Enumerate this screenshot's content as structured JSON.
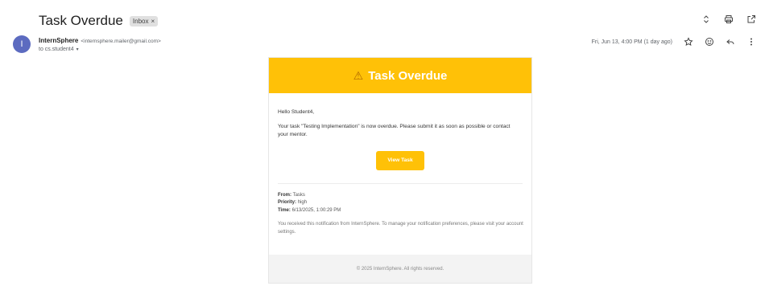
{
  "subject": "Task Overdue",
  "inbox_label": "Inbox",
  "inbox_remove": "×",
  "avatar_initial": "I",
  "sender": {
    "name": "InternSphere",
    "email": "<internsphere.mailer@gmail.com>",
    "to": "to cs.student4",
    "to_caret": "▾"
  },
  "date": "Fri, Jun 13, 4:00 PM (1 day ago)",
  "icons": {
    "expand": "unfold-icon",
    "print": "print-icon",
    "open_new": "open-in-new-icon",
    "star": "star-icon",
    "emoji": "emoji-icon",
    "reply": "reply-icon",
    "more": "more-vert-icon"
  },
  "email": {
    "banner_icon": "⚠",
    "banner_title": "Task Overdue",
    "greeting": "Hello Student4,",
    "message": "Your task \"Testing Implementation\" is now overdue. Please submit it as soon as possible or contact your mentor.",
    "button_label": "View Task",
    "from_label": "From:",
    "from_value": "Tasks",
    "priority_label": "Priority:",
    "priority_value": "high",
    "time_label": "Time:",
    "time_value": "6/13/2025, 1:00:29 PM",
    "notice": "You received this notification from InternSphere. To manage your notification preferences, please visit your account settings.",
    "footer": "© 2025 InternSphere. All rights reserved."
  },
  "colors": {
    "accent": "#ffc107",
    "avatar": "#5c6bc0"
  }
}
